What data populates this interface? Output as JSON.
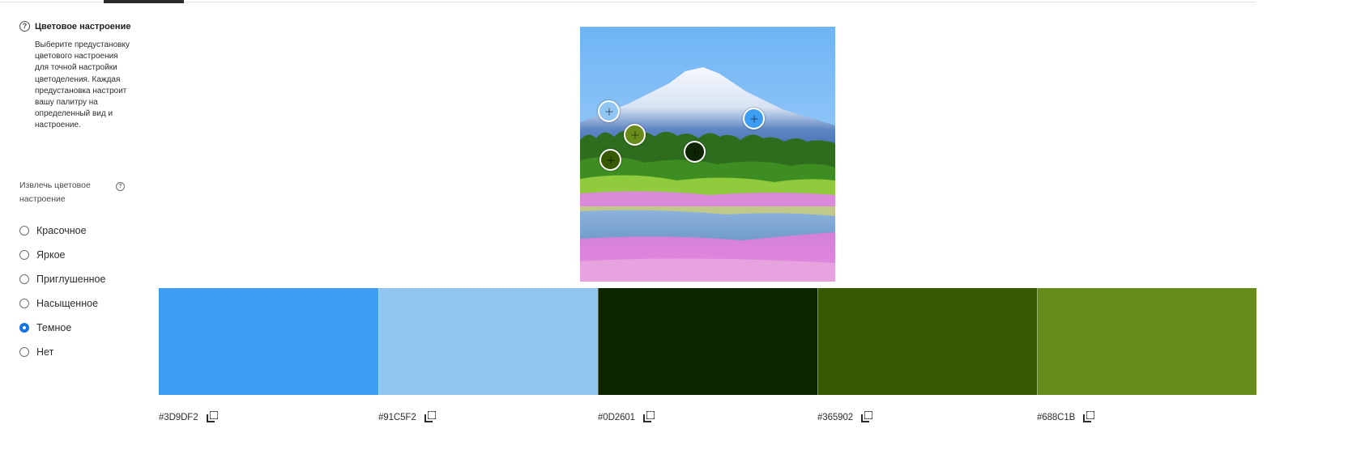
{
  "sidebar": {
    "mood_title": "Цветовое настроение",
    "mood_description": "Выберите предустановку цветового настроения для точной настройки цветоделения. Каждая предустановка настроит вашу палитру на определенный вид и настроение.",
    "extract_label": "Извлечь цветовое настроение",
    "help_icon": "question-circle-icon",
    "moods": [
      {
        "label": "Красочное",
        "checked": false
      },
      {
        "label": "Яркое",
        "checked": false
      },
      {
        "label": "Приглушенное",
        "checked": false
      },
      {
        "label": "Насыщенное",
        "checked": false
      },
      {
        "label": "Темное",
        "checked": true
      },
      {
        "label": "Нет",
        "checked": false
      }
    ]
  },
  "photo": {
    "pickers": [
      {
        "color": "#91C5F2"
      },
      {
        "color": "#688C1B"
      },
      {
        "color": "#365902"
      },
      {
        "color": "#0D2601"
      },
      {
        "color": "#3D9DF2"
      }
    ]
  },
  "palette": [
    {
      "hex": "#3D9DF2",
      "color": "#3D9DF2",
      "copy_icon": "copy-icon"
    },
    {
      "hex": "#91C5F2",
      "color": "#91C5F2",
      "copy_icon": "copy-icon"
    },
    {
      "hex": "#0D2601",
      "color": "#0D2601",
      "copy_icon": "copy-icon"
    },
    {
      "hex": "#365902",
      "color": "#365902",
      "copy_icon": "copy-icon"
    },
    {
      "hex": "#688C1B",
      "color": "#688C1B",
      "copy_icon": "copy-icon"
    }
  ]
}
